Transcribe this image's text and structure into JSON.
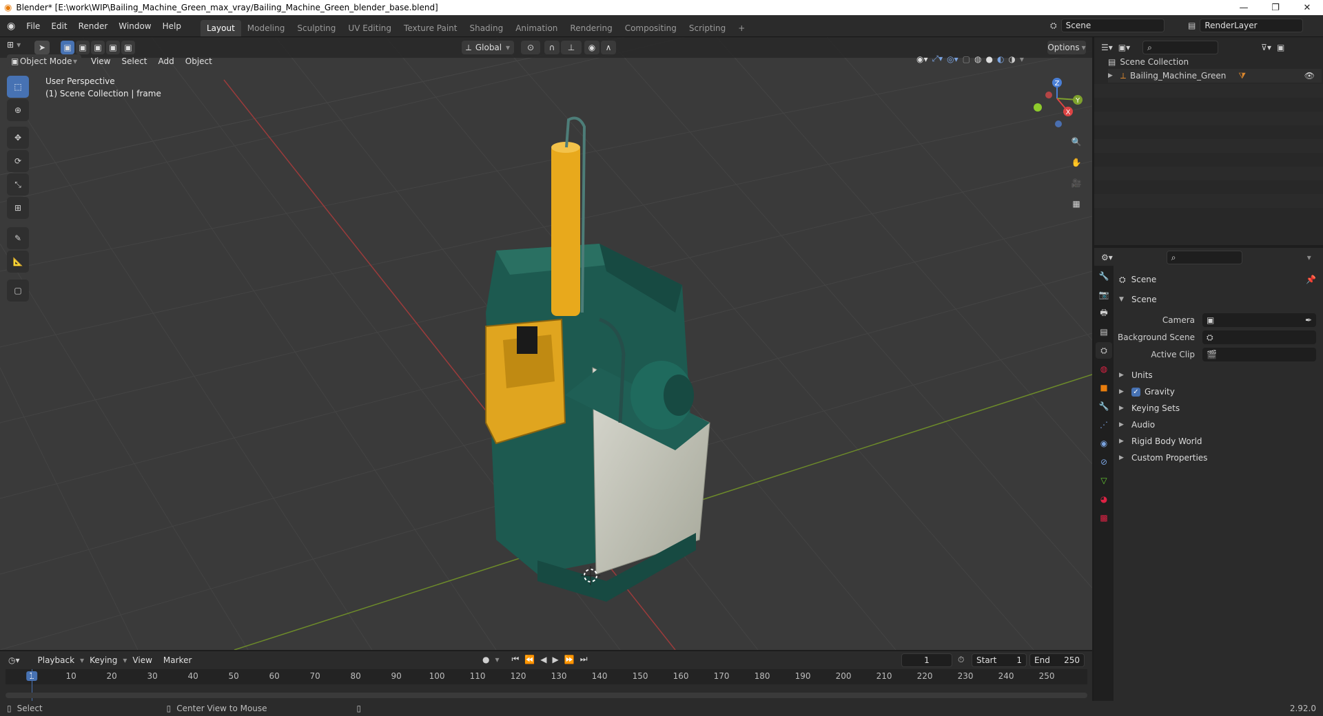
{
  "window": {
    "title": "Blender* [E:\\work\\WIP\\Bailing_Machine_Green_max_vray/Bailing_Machine_Green_blender_base.blend]",
    "minimize": "—",
    "maximize": "❐",
    "close": "✕"
  },
  "menus": [
    "File",
    "Edit",
    "Render",
    "Window",
    "Help"
  ],
  "workspaces": [
    "Layout",
    "Modeling",
    "Sculpting",
    "UV Editing",
    "Texture Paint",
    "Shading",
    "Animation",
    "Rendering",
    "Compositing",
    "Scripting",
    "+"
  ],
  "scene": {
    "name": "Scene",
    "render_layer": "RenderLayer"
  },
  "viewport": {
    "orientation": "Global",
    "options": "Options",
    "mode": "Object Mode",
    "menus": [
      "View",
      "Select",
      "Add",
      "Object"
    ],
    "info_line1": "User Perspective",
    "info_line2": "(1) Scene Collection | frame",
    "gizmo": {
      "x": "X",
      "y": "Y",
      "z": "Z"
    }
  },
  "outliner": {
    "root": "Scene Collection",
    "items": [
      {
        "label": "Bailing_Machine_Green"
      }
    ]
  },
  "properties": {
    "header": "Scene",
    "panel": "Scene",
    "fields": [
      {
        "label": "Camera",
        "value": ""
      },
      {
        "label": "Background Scene",
        "value": ""
      },
      {
        "label": "Active Clip",
        "value": ""
      }
    ],
    "subpanels": [
      "Units",
      "Gravity",
      "Keying Sets",
      "Audio",
      "Rigid Body World",
      "Custom Properties"
    ],
    "gravity_checked": true
  },
  "timeline": {
    "menus": [
      "Playback",
      "Keying",
      "View",
      "Marker"
    ],
    "current_frame": "1",
    "start_label": "Start",
    "start": "1",
    "end_label": "End",
    "end": "250",
    "ticks": [
      "1",
      "10",
      "20",
      "30",
      "40",
      "50",
      "60",
      "70",
      "80",
      "90",
      "100",
      "110",
      "120",
      "130",
      "140",
      "150",
      "160",
      "170",
      "180",
      "190",
      "200",
      "210",
      "220",
      "230",
      "240",
      "250"
    ]
  },
  "status": {
    "left": "Select",
    "middle": "Center View to Mouse",
    "version": "2.92.0"
  },
  "colors": {
    "accent": "#4772b3",
    "machine_green": "#1f5f55",
    "machine_yellow": "#e0a51f",
    "x_axis": "#b54545",
    "y_axis": "#7ea12d"
  }
}
